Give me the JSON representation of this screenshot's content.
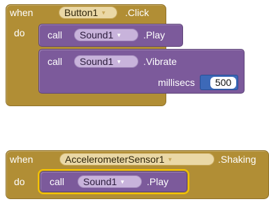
{
  "blocks": [
    {
      "event": {
        "when_label": "when",
        "component": "Button1",
        "event_name": ".Click",
        "do_label": "do"
      },
      "calls": [
        {
          "call_label": "call",
          "component": "Sound1",
          "method": ".Play"
        },
        {
          "call_label": "call",
          "component": "Sound1",
          "method": ".Vibrate",
          "param_label": "millisecs",
          "param_value": "500"
        }
      ]
    },
    {
      "event": {
        "when_label": "when",
        "component": "AccelerometerSensor1",
        "event_name": ".Shaking",
        "do_label": "do"
      },
      "calls": [
        {
          "call_label": "call",
          "component": "Sound1",
          "method": ".Play",
          "selected": true
        }
      ]
    }
  ],
  "colors": {
    "event_block": "#b18e35",
    "procedure_block": "#7c5a9b",
    "number_block": "#3d69b8",
    "selection_highlight": "#f5c400"
  },
  "icons": {
    "dropdown": "triangle-down-icon"
  }
}
